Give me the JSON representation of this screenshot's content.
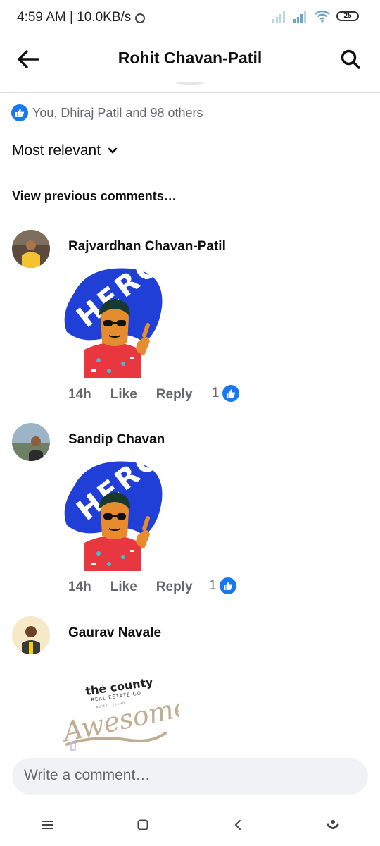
{
  "status": {
    "time_speed": "4:59 AM | 10.0KB/s",
    "battery": "25"
  },
  "header": {
    "title": "Rohit Chavan-Patil"
  },
  "reactions": {
    "text": "You, Dhiraj Patil and 98 others"
  },
  "sort": {
    "label": "Most relevant"
  },
  "view_previous": "View previous comments…",
  "comments": [
    {
      "author": "Rajvardhan Chavan-Patil",
      "sticker_text": "HERO",
      "time": "14h",
      "like": "Like",
      "reply": "Reply",
      "likes": "1"
    },
    {
      "author": "Sandip Chavan",
      "sticker_text": "HERO",
      "time": "14h",
      "like": "Like",
      "reply": "Reply",
      "likes": "1"
    },
    {
      "author": "Gaurav Navale",
      "sticker_brand": "the county",
      "sticker_brand_sub": "REAL ESTATE CO.",
      "sticker_brand_sub2": "BOISE · IDAHO",
      "sticker_text": "Awesome!"
    }
  ],
  "composer": {
    "placeholder": "Write a comment…"
  },
  "colors": {
    "accent": "#1877f2",
    "secondary_text": "#65676b",
    "composer_bg": "#f0f2f5"
  }
}
